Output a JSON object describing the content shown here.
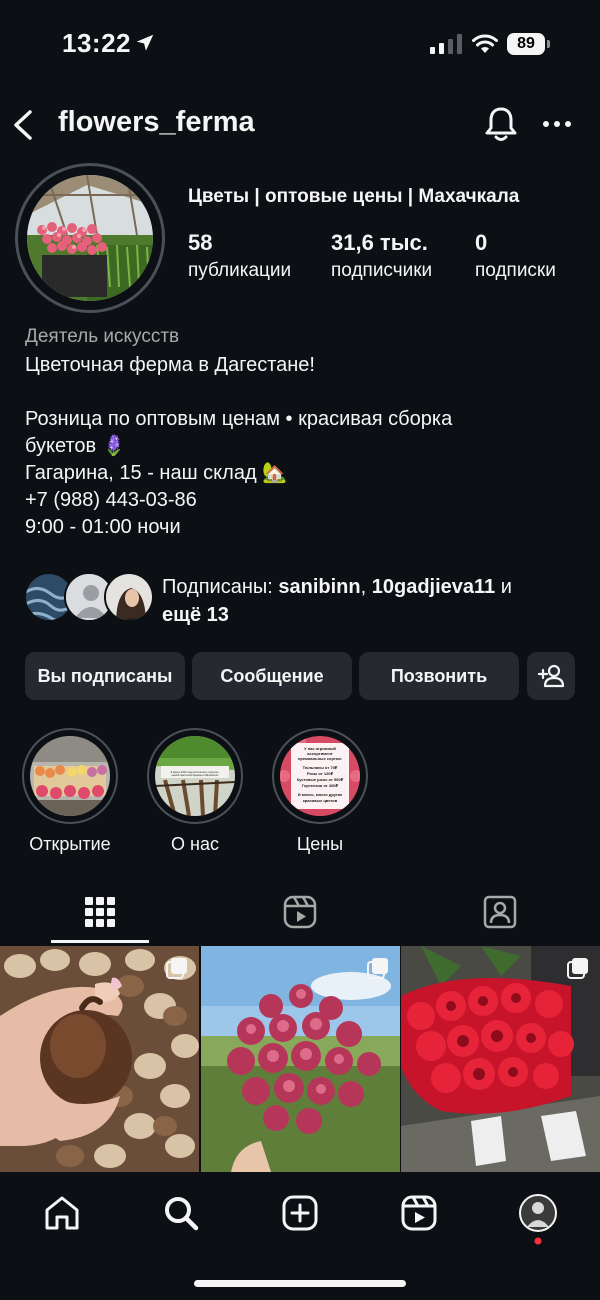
{
  "status_bar": {
    "time": "13:22",
    "battery": "89"
  },
  "header": {
    "username": "flowers_ferma"
  },
  "profile": {
    "name": "Цветы | оптовые цены | Махачкала",
    "stats": [
      {
        "value": "58",
        "label": "публикации"
      },
      {
        "value": "31,6 тыс.",
        "label": "подписчики"
      },
      {
        "value": "0",
        "label": "подписки"
      }
    ],
    "category": "Деятель искусств",
    "bio": [
      "Цветочная ферма в Дагестане!",
      "",
      "Розница по оптовым ценам • красивая сборка",
      "букетов 🪻",
      "Гагарина, 15 - наш склад 🏡",
      "+7 (988) 443-03-86",
      "9:00 - 01:00 ночи"
    ]
  },
  "followed_by": {
    "prefix": "Подписаны: ",
    "user1": "sanibinn",
    "sep": ", ",
    "user2": "10gadjieva11",
    "and": " и",
    "more": "ещё 13"
  },
  "actions": {
    "following": "Вы подписаны",
    "message": "Сообщение",
    "call": "Позвонить"
  },
  "highlights": [
    {
      "label": "Открытие"
    },
    {
      "label": "О нас"
    },
    {
      "label": "Цены"
    }
  ],
  "highlight_price_card": {
    "lines": [
      "У нас огромный",
      "ассортимент",
      "премиальных сортов:",
      "Тюльпаны от 70₽",
      "Розы от 120₽",
      "Кустовые розы от 500₽",
      "Гортензии от 300₽",
      "И много, много других",
      "красивых цветов"
    ]
  },
  "highlight_about_text": "8 марта 2023 года состоялось открытие нашей цветочной фермы в Махачкале!",
  "colors": {
    "background": "#0c1014",
    "button": "#262a30",
    "text": "#f5f5f5",
    "secondary_text": "#a8a8a8",
    "notification_dot": "#ff3040"
  }
}
